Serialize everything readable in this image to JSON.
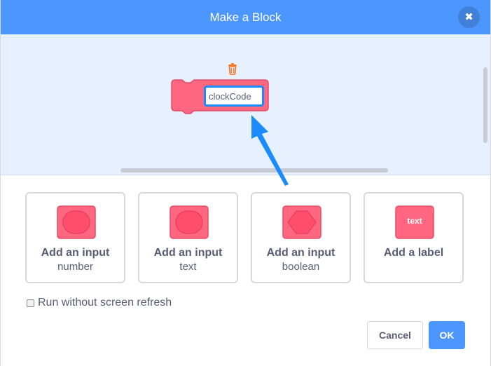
{
  "dialog": {
    "title": "Make a Block",
    "close_icon": "close-icon"
  },
  "editor": {
    "block_name": "clockCode",
    "trash_icon": "trash-icon",
    "block_color": "#ff6680"
  },
  "options": [
    {
      "title": "Add an input",
      "subtitle": "number",
      "icon": "number-input-icon"
    },
    {
      "title": "Add an input",
      "subtitle": "text",
      "icon": "text-input-icon"
    },
    {
      "title": "Add an input",
      "subtitle": "boolean",
      "icon": "boolean-input-icon"
    },
    {
      "title": "Add a label",
      "subtitle": "",
      "icon": "label-icon",
      "icon_text": "text"
    }
  ],
  "run_without_refresh": {
    "label": "Run without screen refresh",
    "checked": false
  },
  "buttons": {
    "cancel": "Cancel",
    "ok": "OK"
  },
  "colors": {
    "header": "#4c97ff",
    "workspace": "#e6f0ff",
    "accent": "#1a8cff",
    "text": "#575e75"
  }
}
